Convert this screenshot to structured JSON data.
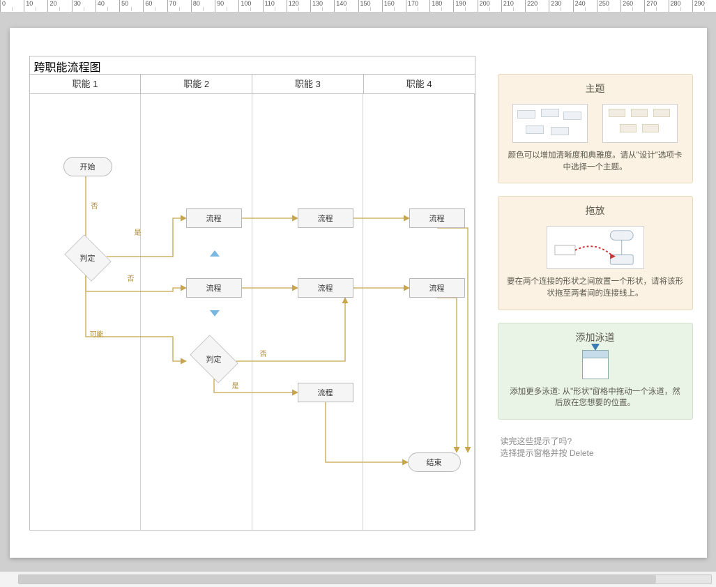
{
  "ruler": {
    "start": 0,
    "step": 10,
    "count": 30
  },
  "diagram": {
    "title": "跨职能流程图",
    "lanes": [
      "职能 1",
      "职能 2",
      "职能 3",
      "职能 4"
    ],
    "shapes": {
      "start": "开始",
      "decision1": "判定",
      "process_r1_l2": "流程",
      "process_r1_l3": "流程",
      "process_r1_l4": "流程",
      "process_r2_l2": "流程",
      "process_r2_l3": "流程",
      "process_r2_l4": "流程",
      "decision2": "判定",
      "process_r4_l3": "流程",
      "end": "结束"
    },
    "labels": {
      "no": "否",
      "yes": "是",
      "maybe": "可能"
    }
  },
  "tips": {
    "theme": {
      "title": "主题",
      "desc": "颜色可以增加清晰度和典雅度。请从\"设计\"选项卡中选择一个主题。"
    },
    "drag": {
      "title": "拖放",
      "desc": "要在两个连接的形状之间放置一个形状，请将该形状拖至两者间的连接线上。"
    },
    "addLane": {
      "title": "添加泳道",
      "desc": "添加更多泳道: 从\"形状\"窗格中拖动一个泳道，然后放在您想要的位置。"
    },
    "footer_q": "读完这些提示了吗?",
    "footer_a": "选择提示窗格并按 Delete"
  }
}
